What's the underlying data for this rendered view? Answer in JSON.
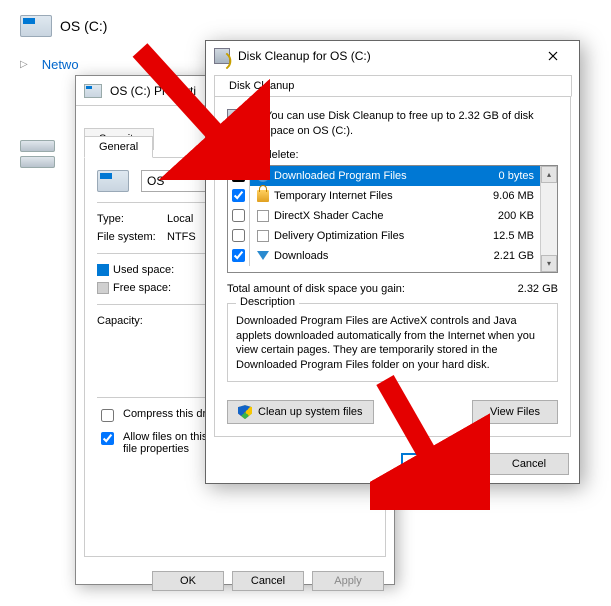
{
  "explorer": {
    "drive_label": "OS (C:)",
    "network_link": "Netwo"
  },
  "props": {
    "title": "OS (C:) Properti",
    "tabs": {
      "security": "Security",
      "general": "General"
    },
    "name_value": "OS",
    "type_label": "Type:",
    "type_value": "Local",
    "fs_label": "File system:",
    "fs_value": "NTFS",
    "used_label": "Used space:",
    "free_label": "Free space:",
    "capacity_label": "Capacity:",
    "compress_label": "Compress this driv",
    "index_label": "Allow files on this\nfile properties",
    "ok": "OK",
    "cancel": "Cancel",
    "apply": "Apply"
  },
  "cleanup": {
    "title": "Disk Cleanup for OS (C:)",
    "tab": "Disk Cleanup",
    "intro": "You can use Disk Cleanup to free up to 2.32 GB of disk space on OS (C:).",
    "files_to_delete_label": "Files to delete:",
    "items": [
      {
        "name": "Downloaded Program Files",
        "size": "0 bytes",
        "checked": true,
        "icon": "world",
        "selected": true
      },
      {
        "name": "Temporary Internet Files",
        "size": "9.06 MB",
        "checked": true,
        "icon": "lock"
      },
      {
        "name": "DirectX Shader Cache",
        "size": "200 KB",
        "checked": false,
        "icon": "file"
      },
      {
        "name": "Delivery Optimization Files",
        "size": "12.5 MB",
        "checked": false,
        "icon": "file"
      },
      {
        "name": "Downloads",
        "size": "2.21 GB",
        "checked": true,
        "icon": "down"
      }
    ],
    "total_label": "Total amount of disk space you gain:",
    "total_value": "2.32 GB",
    "description_label": "Description",
    "description_text": "Downloaded Program Files are ActiveX controls and Java applets downloaded automatically from the Internet when you view certain pages. They are temporarily stored in the Downloaded Program Files folder on your hard disk.",
    "clean_system": "Clean up system files",
    "view_files": "View Files",
    "ok": "OK",
    "cancel": "Cancel"
  }
}
